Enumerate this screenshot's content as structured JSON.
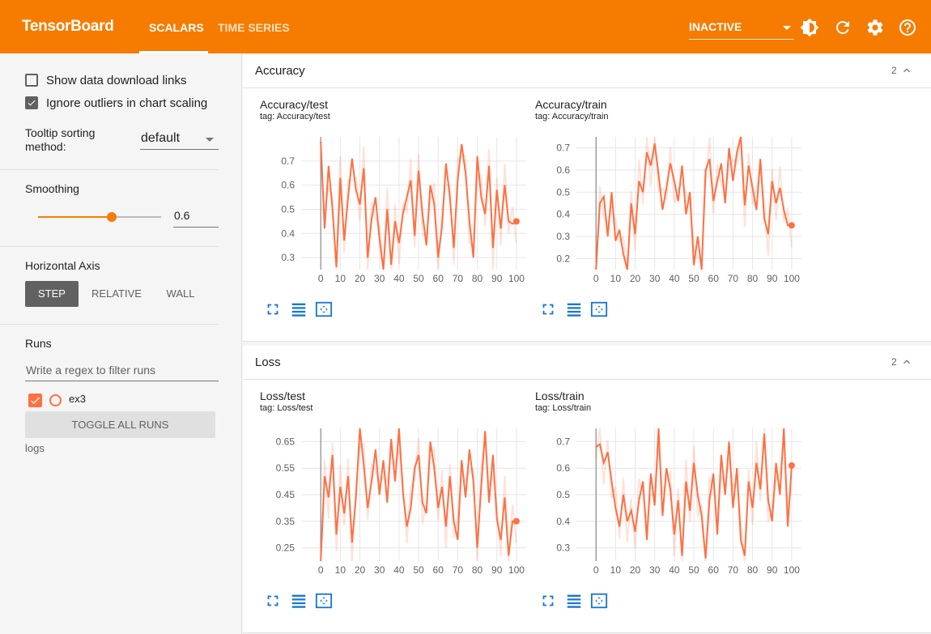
{
  "app": {
    "brand": "TensorBoard",
    "tabs": [
      {
        "label": "SCALARS",
        "active": true
      },
      {
        "label": "TIME SERIES",
        "active": false
      }
    ],
    "status": "INACTIVE",
    "accent": "#f57c00",
    "icons": [
      "theme-contrast-icon",
      "reload-icon",
      "settings-icon",
      "help-icon"
    ]
  },
  "sidebar": {
    "show_download_links": {
      "label": "Show data download links",
      "checked": false
    },
    "ignore_outliers": {
      "label": "Ignore outliers in chart scaling",
      "checked": true
    },
    "tooltip_sort": {
      "label_line1": "Tooltip sorting",
      "label_line2": "method:",
      "value": "default"
    },
    "smoothing": {
      "label": "Smoothing",
      "value": "0.6",
      "level": 0.6
    },
    "horizontal_axis": {
      "label": "Horizontal Axis",
      "options": [
        "STEP",
        "RELATIVE",
        "WALL"
      ],
      "selected": "STEP"
    },
    "runs": {
      "label": "Runs",
      "filter_placeholder": "Write a regex to filter runs",
      "items": [
        {
          "name": "ex3",
          "checked": true,
          "color": "#ff7043"
        }
      ],
      "toggle_all": "TOGGLE ALL RUNS",
      "group": "logs"
    }
  },
  "sections": [
    {
      "title": "Accuracy",
      "count": "2",
      "cards": [
        {
          "title": "Accuracy/test",
          "tag": "tag: Accuracy/test"
        },
        {
          "title": "Accuracy/train",
          "tag": "tag: Accuracy/train"
        }
      ]
    },
    {
      "title": "Loss",
      "count": "2",
      "cards": [
        {
          "title": "Loss/test",
          "tag": "tag: Loss/test"
        },
        {
          "title": "Loss/train",
          "tag": "tag: Loss/train"
        }
      ]
    }
  ],
  "chart_data": [
    {
      "type": "line",
      "title": "Accuracy/test",
      "x_ticks": [
        0,
        10,
        20,
        30,
        40,
        50,
        60,
        70,
        80,
        90,
        100
      ],
      "y_ticks": [
        0.3,
        0.4,
        0.5,
        0.6,
        0.7
      ],
      "xlim": [
        -10,
        105
      ],
      "ylim": [
        0.25,
        0.8
      ],
      "grid": true,
      "series": [
        {
          "name": "ex3",
          "color": "#ff7043",
          "x": [
            0,
            2,
            4,
            6,
            8,
            10,
            12,
            14,
            16,
            18,
            20,
            22,
            24,
            26,
            28,
            30,
            32,
            34,
            36,
            38,
            40,
            42,
            44,
            46,
            48,
            50,
            52,
            54,
            56,
            58,
            60,
            62,
            64,
            66,
            68,
            70,
            72,
            74,
            76,
            78,
            80,
            82,
            84,
            86,
            88,
            90,
            92,
            94,
            96,
            98,
            100
          ],
          "smoothed": [
            0.78,
            0.42,
            0.68,
            0.5,
            0.26,
            0.63,
            0.37,
            0.55,
            0.71,
            0.58,
            0.52,
            0.67,
            0.3,
            0.46,
            0.55,
            0.38,
            0.25,
            0.5,
            0.27,
            0.45,
            0.36,
            0.48,
            0.55,
            0.62,
            0.39,
            0.66,
            0.48,
            0.35,
            0.6,
            0.52,
            0.3,
            0.43,
            0.69,
            0.55,
            0.34,
            0.62,
            0.77,
            0.65,
            0.45,
            0.3,
            0.72,
            0.55,
            0.48,
            0.68,
            0.34,
            0.58,
            0.42,
            0.6,
            0.45,
            0.44,
            0.45
          ]
        }
      ]
    },
    {
      "type": "line",
      "title": "Accuracy/train",
      "x_ticks": [
        0,
        10,
        20,
        30,
        40,
        50,
        60,
        70,
        80,
        90,
        100
      ],
      "y_ticks": [
        0.2,
        0.3,
        0.4,
        0.5,
        0.6,
        0.7
      ],
      "xlim": [
        -10,
        105
      ],
      "ylim": [
        0.15,
        0.75
      ],
      "grid": true,
      "series": [
        {
          "name": "ex3",
          "color": "#ff7043",
          "x": [
            0,
            2,
            4,
            6,
            8,
            10,
            12,
            14,
            16,
            18,
            20,
            22,
            24,
            26,
            28,
            30,
            32,
            34,
            36,
            38,
            40,
            42,
            44,
            46,
            48,
            50,
            52,
            54,
            56,
            58,
            60,
            62,
            64,
            66,
            68,
            70,
            72,
            74,
            76,
            78,
            80,
            82,
            84,
            86,
            88,
            90,
            92,
            94,
            96,
            98,
            100
          ],
          "smoothed": [
            0.15,
            0.45,
            0.48,
            0.3,
            0.5,
            0.28,
            0.33,
            0.22,
            0.15,
            0.45,
            0.31,
            0.55,
            0.5,
            0.68,
            0.62,
            0.72,
            0.58,
            0.42,
            0.52,
            0.63,
            0.55,
            0.46,
            0.62,
            0.4,
            0.5,
            0.17,
            0.3,
            0.15,
            0.6,
            0.65,
            0.46,
            0.55,
            0.63,
            0.45,
            0.7,
            0.55,
            0.68,
            0.75,
            0.44,
            0.62,
            0.52,
            0.42,
            0.65,
            0.38,
            0.31,
            0.55,
            0.45,
            0.52,
            0.42,
            0.35,
            0.35
          ]
        }
      ]
    },
    {
      "type": "line",
      "title": "Loss/test",
      "x_ticks": [
        0,
        10,
        20,
        30,
        40,
        50,
        60,
        70,
        80,
        90,
        100
      ],
      "y_ticks": [
        0.25,
        0.35,
        0.45,
        0.55,
        0.65
      ],
      "xlim": [
        -10,
        105
      ],
      "ylim": [
        0.2,
        0.7
      ],
      "grid": true,
      "series": [
        {
          "name": "ex3",
          "color": "#ff7043",
          "x": [
            0,
            2,
            4,
            6,
            8,
            10,
            12,
            14,
            16,
            18,
            20,
            22,
            24,
            26,
            28,
            30,
            32,
            34,
            36,
            38,
            40,
            42,
            44,
            46,
            48,
            50,
            52,
            54,
            56,
            58,
            60,
            62,
            64,
            66,
            68,
            70,
            72,
            74,
            76,
            78,
            80,
            82,
            84,
            86,
            88,
            90,
            92,
            94,
            96,
            98,
            100
          ],
          "smoothed": [
            0.2,
            0.52,
            0.44,
            0.6,
            0.3,
            0.48,
            0.38,
            0.52,
            0.27,
            0.44,
            0.7,
            0.56,
            0.4,
            0.5,
            0.62,
            0.45,
            0.58,
            0.42,
            0.66,
            0.5,
            0.7,
            0.46,
            0.33,
            0.4,
            0.55,
            0.6,
            0.42,
            0.38,
            0.65,
            0.55,
            0.4,
            0.48,
            0.33,
            0.52,
            0.35,
            0.28,
            0.58,
            0.44,
            0.62,
            0.5,
            0.25,
            0.48,
            0.69,
            0.42,
            0.6,
            0.36,
            0.28,
            0.44,
            0.22,
            0.35,
            0.35
          ]
        }
      ]
    },
    {
      "type": "line",
      "title": "Loss/train",
      "x_ticks": [
        0,
        10,
        20,
        30,
        40,
        50,
        60,
        70,
        80,
        90,
        100
      ],
      "y_ticks": [
        0.3,
        0.4,
        0.5,
        0.6,
        0.7
      ],
      "xlim": [
        -10,
        105
      ],
      "ylim": [
        0.25,
        0.75
      ],
      "grid": true,
      "series": [
        {
          "name": "ex3",
          "color": "#ff7043",
          "x": [
            0,
            2,
            4,
            6,
            8,
            10,
            12,
            14,
            16,
            18,
            20,
            22,
            24,
            26,
            28,
            30,
            32,
            34,
            36,
            38,
            40,
            42,
            44,
            46,
            48,
            50,
            52,
            54,
            56,
            58,
            60,
            62,
            64,
            66,
            68,
            70,
            72,
            74,
            76,
            78,
            80,
            82,
            84,
            86,
            88,
            90,
            92,
            94,
            96,
            98,
            100
          ],
          "smoothed": [
            0.68,
            0.69,
            0.62,
            0.66,
            0.55,
            0.45,
            0.38,
            0.5,
            0.4,
            0.44,
            0.36,
            0.48,
            0.55,
            0.33,
            0.58,
            0.46,
            0.75,
            0.42,
            0.6,
            0.52,
            0.35,
            0.48,
            0.27,
            0.55,
            0.44,
            0.62,
            0.5,
            0.42,
            0.26,
            0.48,
            0.58,
            0.35,
            0.65,
            0.5,
            0.7,
            0.45,
            0.6,
            0.33,
            0.27,
            0.55,
            0.45,
            0.62,
            0.52,
            0.73,
            0.48,
            0.4,
            0.62,
            0.5,
            0.75,
            0.38,
            0.61
          ]
        }
      ]
    }
  ]
}
